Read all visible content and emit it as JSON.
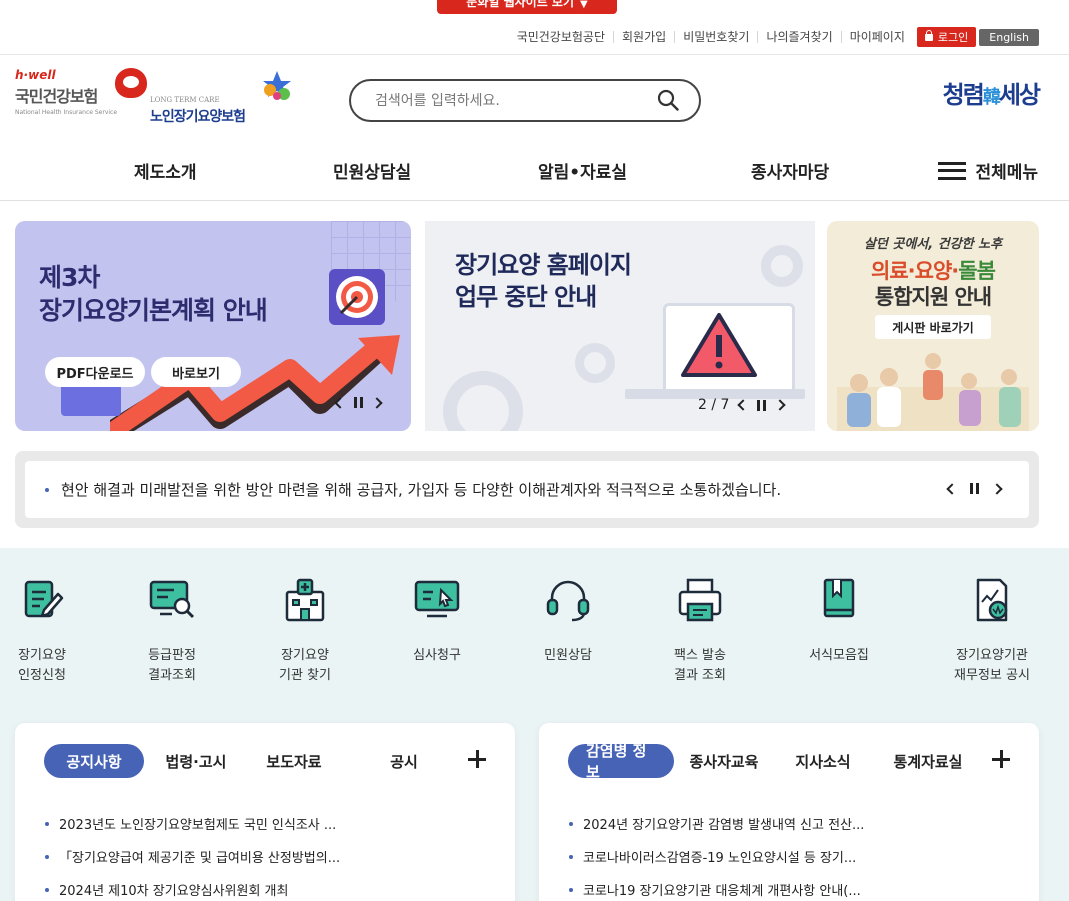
{
  "top_tab": {
    "label": "문화일 웹사이트 보기"
  },
  "util_links": [
    "국민건강보험공단",
    "회원가입",
    "비밀번호찾기",
    "나의즐겨찾기",
    "마이페이지"
  ],
  "util_login": "로그인",
  "util_english": "English",
  "logo_nhis": {
    "hwell": "h·well",
    "name": "국민건강보험",
    "sub": "National Health Insurance Service"
  },
  "logo_ltc": {
    "small": "LONG TERM CARE",
    "name": "노인장기요양보험"
  },
  "search": {
    "placeholder": "검색어를 입력하세요."
  },
  "brand_right": {
    "left": "청렴",
    "mid": "韓",
    "right": "세상"
  },
  "gnb": {
    "items": [
      "제도소개",
      "민원상담실",
      "알림•자료실",
      "종사자마당"
    ],
    "all_menu": "전체메뉴"
  },
  "banners": {
    "b1": {
      "title_line1": "제3차",
      "title_line2": "장기요양기본계획 안내",
      "btn_pdf": "PDF다운로드",
      "btn_view": "바로보기"
    },
    "b2": {
      "title_line1": "장기요양 홈페이지",
      "title_line2": "업무 중단 안내",
      "counter": "2 / 7"
    },
    "b3": {
      "line1": "살던 곳에서, 건강한 노후",
      "line2_a": "의료·요양·",
      "line2_b": "돌봄",
      "line3": "통합지원 안내",
      "button": "게시판 바로가기"
    }
  },
  "notice_ticker": {
    "text": "현안 해결과 미래발전을 위한 방안 마련을 위해 공급자, 가입자 등 다양한 이해관계자와 적극적으로 소통하겠습니다."
  },
  "quick_menu": [
    {
      "line1": "장기요양",
      "line2": "인정신청",
      "icon": "pencil-document-icon"
    },
    {
      "line1": "등급판정",
      "line2": "결과조회",
      "icon": "monitor-search-icon"
    },
    {
      "line1": "장기요양",
      "line2": "기관 찾기",
      "icon": "hospital-icon"
    },
    {
      "line1": "심사청구",
      "line2": "",
      "icon": "monitor-cursor-icon"
    },
    {
      "line1": "민원상담",
      "line2": "",
      "icon": "headset-icon"
    },
    {
      "line1": "팩스 발송",
      "line2": "결과 조회",
      "icon": "fax-icon"
    },
    {
      "line1": "서식모음집",
      "line2": "",
      "icon": "book-icon"
    },
    {
      "line1": "장기요양기관",
      "line2": "재무정보 공시",
      "icon": "finance-document-icon"
    }
  ],
  "board_left": {
    "tabs": [
      "공지사항",
      "법령·고시",
      "보도자료",
      "공시"
    ],
    "items": [
      "2023년도 노인장기요양보험제도 국민 인식조사 ...",
      "「장기요양급여 제공기준 및 급여비용 산정방법의...",
      "2024년 제10차 장기요양심사위원회 개최"
    ]
  },
  "board_right": {
    "tabs": [
      "감염병 정보",
      "종사자교육",
      "지사소식",
      "통계자료실"
    ],
    "items": [
      "2024년 장기요양기관 감염병 발생내역 신고 전산...",
      "코로나바이러스감염증-19 노인요양시설 등 장기...",
      "코로나19 장기요양기관 대응체계 개편사항 안내(..."
    ]
  },
  "colors": {
    "accent_red": "#d8271c",
    "accent_blue": "#4763b5",
    "band_bg": "#eaf4f5",
    "icon_teal": "#3dbfa0"
  }
}
